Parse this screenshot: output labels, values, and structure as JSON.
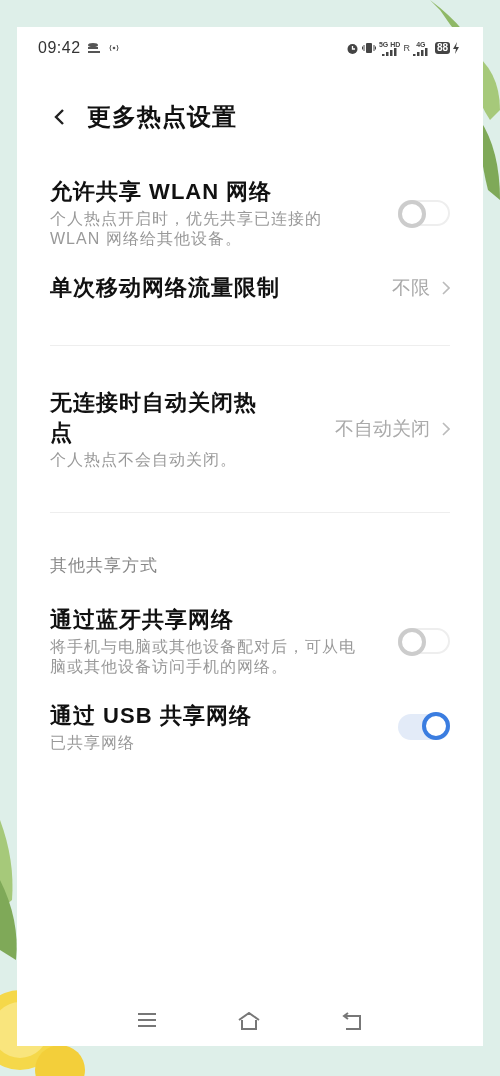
{
  "status_bar": {
    "time": "09:42",
    "network_5g": "5G HD",
    "network_4g": "4G",
    "roaming": "R",
    "battery": "88"
  },
  "header": {
    "title": "更多热点设置"
  },
  "items": [
    {
      "kind": "toggle",
      "title": "允许共享 WLAN 网络",
      "subtitle": "个人热点开启时，优先共享已连接的WLAN 网络给其他设备。",
      "on": false
    },
    {
      "kind": "value",
      "title": "单次移动网络流量限制",
      "value": "不限"
    },
    {
      "kind": "divider"
    },
    {
      "kind": "value",
      "title": "无连接时自动关闭热点",
      "value": "不自动关闭",
      "subtitle": "个人热点不会自动关闭。"
    },
    {
      "kind": "divider"
    },
    {
      "kind": "section",
      "title": "其他共享方式"
    },
    {
      "kind": "toggle",
      "title": "通过蓝牙共享网络",
      "subtitle": "将手机与电脑或其他设备配对后，可从电脑或其他设备访问手机的网络。",
      "on": false
    },
    {
      "kind": "toggle",
      "title": "通过 USB 共享网络",
      "subtitle": "已共享网络",
      "on": true
    }
  ]
}
